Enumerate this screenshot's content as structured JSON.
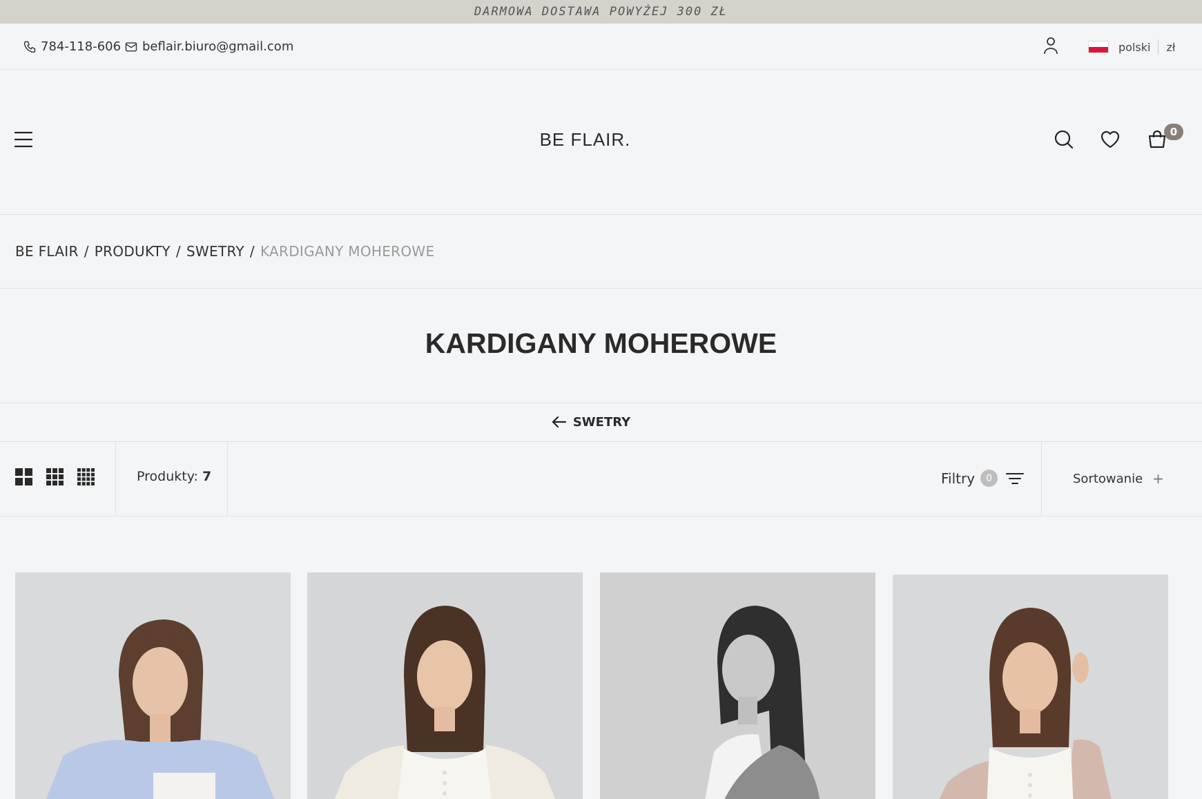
{
  "announcement": "DARMOWA DOSTAWA POWYŻEJ 300 ZŁ",
  "topbar": {
    "phone": "784-118-606",
    "email": "beflair.biuro@gmail.com",
    "language": "polski",
    "currency": "zł"
  },
  "header": {
    "logo": "BE FLAIR.",
    "cart_count": "0"
  },
  "breadcrumb": {
    "items": [
      "BE FLAIR",
      "PRODUKTY",
      "SWETRY"
    ],
    "separator": "/",
    "current": "KARDIGANY MOHEROWE"
  },
  "page": {
    "title": "KARDIGANY MOHEROWE",
    "back_label": "SWETRY"
  },
  "toolbar": {
    "products_label": "Produkty:",
    "products_count": "7",
    "filters_label": "Filtry",
    "filters_count": "0",
    "sort_label": "Sortowanie",
    "sort_icon": "+"
  },
  "products": [
    {
      "image": "model-blue-mohair-cardigan",
      "color": "#b9c8e6"
    },
    {
      "image": "model-cream-mohair-cardigan",
      "color": "#efebe1"
    },
    {
      "image": "model-grey-mohair-cardigan",
      "color": "#8d8d8d"
    },
    {
      "image": "model-pink-mohair-cardigan",
      "color": "#d3b8ad"
    }
  ],
  "colors": {
    "announce_bg": "#d5d1cb",
    "page_bg": "#f4f5f7",
    "badge_bg": "#8a7f77",
    "breadcrumb_current": "#9a9a9a"
  }
}
